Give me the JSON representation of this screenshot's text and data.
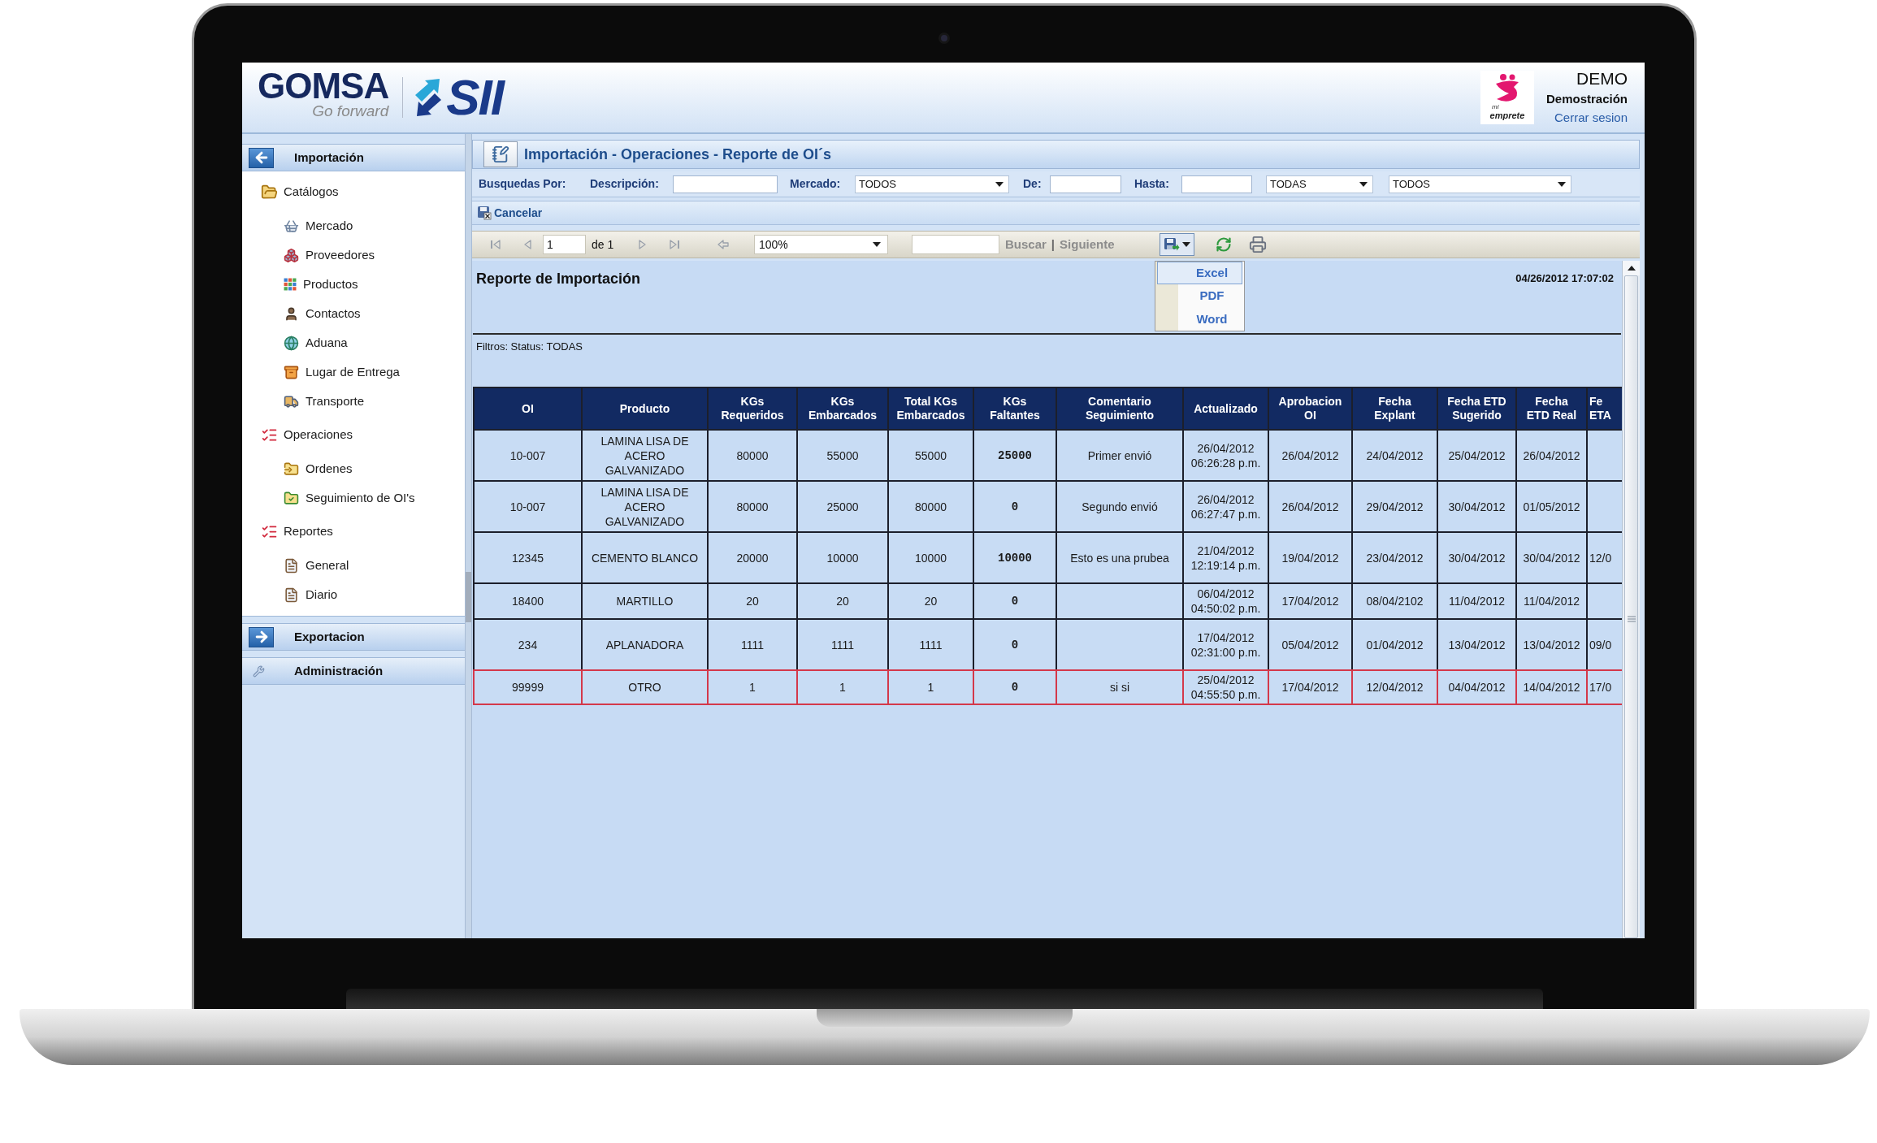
{
  "header": {
    "logo": {
      "name": "GOMSA",
      "tagline": "Go forward",
      "product": "SII"
    },
    "partner_logo": {
      "small_text": "mi",
      "name": "emprete"
    },
    "user": {
      "code": "DEMO",
      "name": "Demostración",
      "logout": "Cerrar sesion"
    }
  },
  "sidebar": {
    "panels": [
      {
        "label": "Importación",
        "kind": "module",
        "expanded": true,
        "children": [
          {
            "label": "Catálogos",
            "children": [
              {
                "label": "Mercado"
              },
              {
                "label": "Proveedores"
              },
              {
                "label": "Productos"
              },
              {
                "label": "Contactos"
              },
              {
                "label": "Aduana"
              },
              {
                "label": "Lugar de Entrega"
              },
              {
                "label": "Transporte"
              }
            ]
          },
          {
            "label": "Operaciones",
            "children": [
              {
                "label": "Ordenes"
              },
              {
                "label": "Seguimiento de OI's"
              }
            ]
          },
          {
            "label": "Reportes",
            "children": [
              {
                "label": "General"
              },
              {
                "label": "Diario"
              }
            ]
          }
        ]
      },
      {
        "label": "Exportacion",
        "kind": "module",
        "expanded": false
      },
      {
        "label": "Administración",
        "kind": "tool"
      }
    ]
  },
  "page": {
    "title": "Importación - Operaciones - Reporte de OI´s",
    "search": {
      "label": "Busquedas Por:",
      "fields": [
        {
          "kind": "input",
          "label": "Descripción:"
        },
        {
          "kind": "select",
          "label": "Mercado:",
          "value": "TODOS"
        },
        {
          "kind": "input",
          "label": "De:"
        },
        {
          "kind": "input",
          "label": "Hasta:"
        },
        {
          "kind": "select",
          "value": "TODAS"
        },
        {
          "kind": "select",
          "value": "TODOS"
        }
      ]
    },
    "action_bar": {
      "cancel": "Cancelar"
    }
  },
  "report_toolbar": {
    "pager": {
      "page": "1",
      "total": "de 1",
      "disabled": true
    },
    "zoom": "100%",
    "find": {
      "search_label": "Buscar",
      "separator": "|",
      "next_label": "Siguiente",
      "disabled": true
    },
    "export": {
      "open": true,
      "items": [
        {
          "label": "Excel",
          "selected": true
        },
        {
          "label": "PDF",
          "selected": false
        },
        {
          "label": "Word",
          "selected": false
        }
      ]
    }
  },
  "report": {
    "title": "Reporte de Importación",
    "timestamp": "04/26/2012 17:07:02",
    "filters": "Filtros: Status: TODAS",
    "table": {
      "columns": [
        {
          "label": "OI",
          "kind": "text"
        },
        {
          "label": "Producto",
          "kind": "text"
        },
        {
          "label": "KGs\nRequeridos",
          "kind": "text"
        },
        {
          "label": "KGs\nEmbarcados",
          "kind": "text"
        },
        {
          "label": "Total KGs\nEmbarcados",
          "kind": "text"
        },
        {
          "label": "KGs\nFaltantes",
          "kind": "mono"
        },
        {
          "label": "Comentario\nSeguimiento",
          "kind": "text"
        },
        {
          "label": "Actualizado",
          "kind": "text"
        },
        {
          "label": "Aprobacion\nOI",
          "kind": "text"
        },
        {
          "label": "Fecha\nExplant",
          "kind": "text"
        },
        {
          "label": "Fecha ETD\nSugerido",
          "kind": "text"
        },
        {
          "label": "Fecha\nETD Real",
          "kind": "text"
        },
        {
          "label": "Fe\nETA",
          "kind": "cut"
        }
      ],
      "rows": [
        {
          "selected": false,
          "cells": [
            "10-007",
            "LAMINA LISA DE\nACERO\nGALVANIZADO",
            "80000",
            "55000",
            "55000",
            "25000",
            "Primer envió",
            "26/04/2012\n06:26:28 p.m.",
            "26/04/2012",
            "24/04/2012",
            "25/04/2012",
            "26/04/2012",
            null
          ]
        },
        {
          "selected": false,
          "cells": [
            "10-007",
            "LAMINA LISA DE\nACERO\nGALVANIZADO",
            "80000",
            "25000",
            "80000",
            "0",
            "Segundo envió",
            "26/04/2012\n06:27:47 p.m.",
            "26/04/2012",
            "29/04/2012",
            "30/04/2012",
            "01/05/2012",
            null
          ]
        },
        {
          "selected": false,
          "cells": [
            "12345",
            "CEMENTO BLANCO",
            "20000",
            "10000",
            "10000",
            "10000",
            "Esto es una prubea",
            "21/04/2012\n12:19:14 p.m.",
            "19/04/2012",
            "23/04/2012",
            "30/04/2012",
            "30/04/2012",
            "12/0"
          ]
        },
        {
          "selected": false,
          "cells": [
            "18400",
            "MARTILLO",
            "20",
            "20",
            "20",
            "0",
            null,
            "06/04/2012\n04:50:02 p.m.",
            "17/04/2012",
            "08/04/2102",
            "11/04/2012",
            "11/04/2012",
            null
          ]
        },
        {
          "selected": false,
          "cells": [
            "234",
            "APLANADORA",
            "1111",
            "1111",
            "1111",
            "0",
            null,
            "17/04/2012\n02:31:00 p.m.",
            "05/04/2012",
            "01/04/2012",
            "13/04/2012",
            "13/04/2012",
            "09/0"
          ]
        },
        {
          "selected": true,
          "cells": [
            "99999",
            "OTRO",
            "1",
            "1",
            "1",
            "0",
            "si si",
            "25/04/2012\n04:55:50 p.m.",
            "17/04/2012",
            "12/04/2012",
            "04/04/2012",
            "14/04/2012",
            "17/0"
          ]
        }
      ]
    }
  }
}
